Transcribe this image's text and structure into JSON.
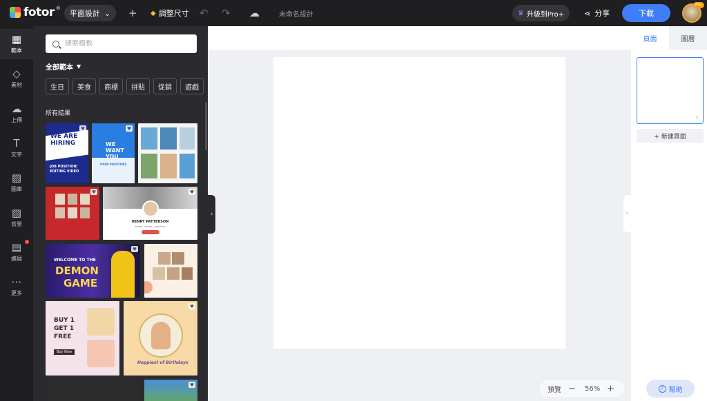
{
  "topbar": {
    "logo_text": "fotor",
    "logo_reg": "®",
    "design_type": "平面設計",
    "resize_label": "調整尺寸",
    "document_name": "未命名設計",
    "upgrade_label": "升級到Pro+",
    "share_label": "分享",
    "download_label": "下載",
    "pro_badge": "Pro"
  },
  "rail": {
    "items": [
      {
        "label": "範本",
        "icon": "layout-icon"
      },
      {
        "label": "素材",
        "icon": "shapes-icon"
      },
      {
        "label": "上傳",
        "icon": "upload-icon"
      },
      {
        "label": "文字",
        "icon": "text-icon"
      },
      {
        "label": "圖庫",
        "icon": "image-icon"
      },
      {
        "label": "背景",
        "icon": "background-icon"
      },
      {
        "label": "擴展",
        "icon": "apps-icon"
      },
      {
        "label": "更多",
        "icon": "more-icon"
      }
    ]
  },
  "panel": {
    "search_placeholder": "搜索模板",
    "all_templates": "全部範本",
    "chips": [
      "生日",
      "美食",
      "商標",
      "拼貼",
      "促銷",
      "遊戲"
    ],
    "results_label": "所有結果",
    "templates": {
      "hiring_title": "WE ARE HIRING",
      "hiring_sub": "JOB POSITION: EDITING VIDEO",
      "want_you": "WE WANT YOU",
      "want_sub": "OPEN POSITIONS",
      "henry_name": "HENRY PATTERSON",
      "henry_sub": "MODEL | TRAVEL | LIFESTYLE",
      "demon_line1": "WELCOME TO THE",
      "demon_line2": "DEMON",
      "demon_line3": "GAME",
      "buy_line1": "BUY 1",
      "buy_line2": "GET 1",
      "buy_line3": "FREE",
      "buy_button": "Buy Now",
      "birthday_text": "Happiest of Birthdays"
    }
  },
  "canvas": {
    "zoom_preview": "預覽",
    "zoom_minus": "−",
    "zoom_value": "56%",
    "zoom_plus": "+"
  },
  "right_panel": {
    "tab_pages": "頁面",
    "tab_layers": "圖層",
    "page_number": "1",
    "new_page": "+ 新建頁面",
    "help": "幫助"
  },
  "colors": {
    "accent": "#3f7ef8",
    "dark_bg": "#1f1f22",
    "panel_bg": "#2b2b2f"
  }
}
